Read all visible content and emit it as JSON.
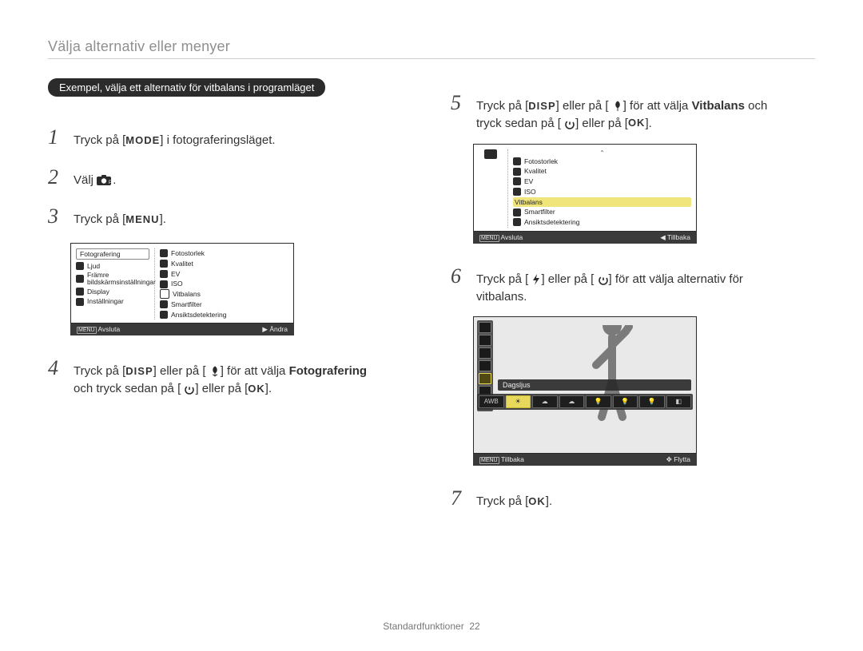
{
  "page_title": "Välja alternativ eller menyer",
  "example_pill": "Exempel, välja ett alternativ för vitbalans i programläget",
  "steps": {
    "s1": {
      "num": "1",
      "pre": "Tryck på [",
      "btn": "MODE",
      "post": "] i fotograferingsläget."
    },
    "s2": {
      "num": "2",
      "text": "Välj ",
      "icon_hint": "camera-p-icon",
      "suffix": "."
    },
    "s3": {
      "num": "3",
      "pre": "Tryck på [",
      "btn": "MENU",
      "post": "]."
    },
    "s4": {
      "num": "4",
      "line_a_pre": "Tryck på [",
      "disp": "DISP",
      "line_a_mid": "] eller på [",
      "macro_hint": "macro-icon",
      "line_a_post": "] för att välja ",
      "bold": "Fotografering",
      "line_b_pre": "och tryck sedan på [",
      "timer_hint": "timer-icon",
      "line_b_mid": "] eller på [",
      "ok": "OK",
      "line_b_post": "]."
    },
    "s5": {
      "num": "5",
      "line_a_pre": "Tryck på [",
      "disp": "DISP",
      "line_a_mid": "] eller på [",
      "macro_hint": "macro-icon",
      "line_a_post": "] för att välja ",
      "bold": "Vitbalans",
      "line_a_after": " och",
      "line_b_pre": "tryck sedan på [",
      "timer_hint": "timer-icon",
      "line_b_mid": "] eller på [",
      "ok": "OK",
      "line_b_post": "]."
    },
    "s6": {
      "num": "6",
      "line_a_pre": "Tryck på [",
      "flash_hint": "flash-icon",
      "line_a_mid": "] eller på [",
      "timer_hint": "timer-icon",
      "line_a_post": "] för att välja alternativ för",
      "line_b": "vitbalans."
    },
    "s7": {
      "num": "7",
      "pre": "Tryck på [",
      "ok": "OK",
      "post": "]."
    }
  },
  "ui1": {
    "left_tabs": [
      "Fotografering",
      "Ljud",
      "Främre bildskärmsinställningar",
      "Display",
      "Inställningar"
    ],
    "right_items": [
      "Fotostorlek",
      "Kvalitet",
      "EV",
      "ISO",
      "Vitbalans",
      "Smartfilter",
      "Ansiktsdetektering"
    ],
    "footer_left_icon": "MENU",
    "footer_left": "Avsluta",
    "footer_right_icon": "▶",
    "footer_right": "Ändra"
  },
  "ui2": {
    "right_items": [
      "Fotostorlek",
      "Kvalitet",
      "EV",
      "ISO",
      "Vitbalans",
      "Smartfilter",
      "Ansiktsdetektering"
    ],
    "highlight": "Vitbalans",
    "footer_left_icon": "MENU",
    "footer_left": "Avsluta",
    "footer_right_icon": "◀",
    "footer_right": "Tillbaka"
  },
  "ui3": {
    "selected_label": "Dagsljus",
    "wb_row": [
      "AWB",
      "☀",
      "☁",
      "☁",
      "💡",
      "💡",
      "💡",
      "◧"
    ],
    "footer_left_icon": "MENU",
    "footer_left": "Tillbaka",
    "footer_right_icon": "✥",
    "footer_right": "Flytta"
  },
  "footer": {
    "label": "Standardfunktioner",
    "page_no": "22"
  }
}
